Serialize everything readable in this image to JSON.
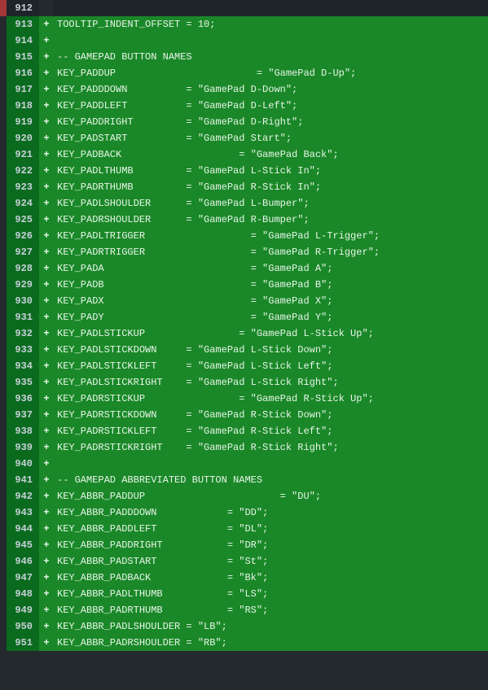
{
  "lines": [
    {
      "num": "912",
      "type": "context",
      "marker": "red",
      "code": ""
    },
    {
      "num": "913",
      "type": "added",
      "code": "TOOLTIP_INDENT_OFFSET = 10;"
    },
    {
      "num": "914",
      "type": "added",
      "code": ""
    },
    {
      "num": "915",
      "type": "added",
      "code": "-- GAMEPAD BUTTON NAMES"
    },
    {
      "num": "916",
      "type": "added",
      "code": "KEY_PADDUP                        = \"GamePad D-Up\";"
    },
    {
      "num": "917",
      "type": "added",
      "code": "KEY_PADDDOWN          = \"GamePad D-Down\";"
    },
    {
      "num": "918",
      "type": "added",
      "code": "KEY_PADDLEFT          = \"GamePad D-Left\";"
    },
    {
      "num": "919",
      "type": "added",
      "code": "KEY_PADDRIGHT         = \"GamePad D-Right\";"
    },
    {
      "num": "920",
      "type": "added",
      "code": "KEY_PADSTART          = \"GamePad Start\";"
    },
    {
      "num": "921",
      "type": "added",
      "code": "KEY_PADBACK                    = \"GamePad Back\";"
    },
    {
      "num": "922",
      "type": "added",
      "code": "KEY_PADLTHUMB         = \"GamePad L-Stick In\";"
    },
    {
      "num": "923",
      "type": "added",
      "code": "KEY_PADRTHUMB         = \"GamePad R-Stick In\";"
    },
    {
      "num": "924",
      "type": "added",
      "code": "KEY_PADLSHOULDER      = \"GamePad L-Bumper\";"
    },
    {
      "num": "925",
      "type": "added",
      "code": "KEY_PADRSHOULDER      = \"GamePad R-Bumper\";"
    },
    {
      "num": "926",
      "type": "added",
      "code": "KEY_PADLTRIGGER                  = \"GamePad L-Trigger\";"
    },
    {
      "num": "927",
      "type": "added",
      "code": "KEY_PADRTRIGGER                  = \"GamePad R-Trigger\";"
    },
    {
      "num": "928",
      "type": "added",
      "code": "KEY_PADA                         = \"GamePad A\";"
    },
    {
      "num": "929",
      "type": "added",
      "code": "KEY_PADB                         = \"GamePad B\";"
    },
    {
      "num": "930",
      "type": "added",
      "code": "KEY_PADX                         = \"GamePad X\";"
    },
    {
      "num": "931",
      "type": "added",
      "code": "KEY_PADY                         = \"GamePad Y\";"
    },
    {
      "num": "932",
      "type": "added",
      "code": "KEY_PADLSTICKUP                = \"GamePad L-Stick Up\";"
    },
    {
      "num": "933",
      "type": "added",
      "code": "KEY_PADLSTICKDOWN     = \"GamePad L-Stick Down\";"
    },
    {
      "num": "934",
      "type": "added",
      "code": "KEY_PADLSTICKLEFT     = \"GamePad L-Stick Left\";"
    },
    {
      "num": "935",
      "type": "added",
      "code": "KEY_PADLSTICKRIGHT    = \"GamePad L-Stick Right\";"
    },
    {
      "num": "936",
      "type": "added",
      "code": "KEY_PADRSTICKUP                = \"GamePad R-Stick Up\";"
    },
    {
      "num": "937",
      "type": "added",
      "code": "KEY_PADRSTICKDOWN     = \"GamePad R-Stick Down\";"
    },
    {
      "num": "938",
      "type": "added",
      "code": "KEY_PADRSTICKLEFT     = \"GamePad R-Stick Left\";"
    },
    {
      "num": "939",
      "type": "added",
      "code": "KEY_PADRSTICKRIGHT    = \"GamePad R-Stick Right\";"
    },
    {
      "num": "940",
      "type": "added",
      "code": ""
    },
    {
      "num": "941",
      "type": "added",
      "code": "-- GAMEPAD ABBREVIATED BUTTON NAMES"
    },
    {
      "num": "942",
      "type": "added",
      "code": "KEY_ABBR_PADDUP                       = \"DU\";"
    },
    {
      "num": "943",
      "type": "added",
      "code": "KEY_ABBR_PADDDOWN            = \"DD\";"
    },
    {
      "num": "944",
      "type": "added",
      "code": "KEY_ABBR_PADDLEFT            = \"DL\";"
    },
    {
      "num": "945",
      "type": "added",
      "code": "KEY_ABBR_PADDRIGHT           = \"DR\";"
    },
    {
      "num": "946",
      "type": "added",
      "code": "KEY_ABBR_PADSTART            = \"St\";"
    },
    {
      "num": "947",
      "type": "added",
      "code": "KEY_ABBR_PADBACK             = \"Bk\";"
    },
    {
      "num": "948",
      "type": "added",
      "code": "KEY_ABBR_PADLTHUMB           = \"LS\";"
    },
    {
      "num": "949",
      "type": "added",
      "code": "KEY_ABBR_PADRTHUMB           = \"RS\";"
    },
    {
      "num": "950",
      "type": "added",
      "code": "KEY_ABBR_PADLSHOULDER = \"LB\";"
    },
    {
      "num": "951",
      "type": "added",
      "code": "KEY_ABBR_PADRSHOULDER = \"RB\";"
    }
  ]
}
